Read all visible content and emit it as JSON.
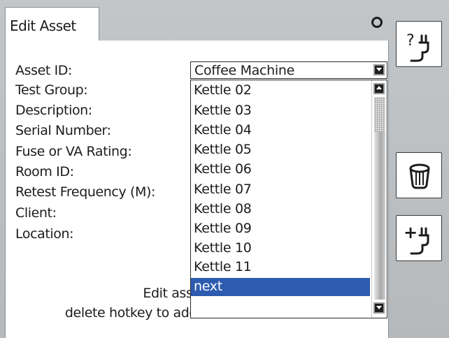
{
  "tab": {
    "title": "Edit Asset"
  },
  "form": {
    "labels": [
      "Asset ID:",
      "Test Group:",
      "Description:",
      "Serial Number:",
      "Fuse or VA Rating:",
      "Room ID:",
      "Retest Frequency (M):",
      "Client:",
      "Location:"
    ],
    "asset_id_value": "Coffee Machine"
  },
  "dropdown": {
    "items": [
      "Kettle 02",
      "Kettle 03",
      "Kettle 04",
      "Kettle 05",
      "Kettle 06",
      "Kettle 07",
      "Kettle 08",
      "Kettle 09",
      "Kettle 10",
      "Kettle 11"
    ],
    "selected_item": "next"
  },
  "hint": {
    "line1": "Edit asset inform",
    "line2": "delete hotkey to add or remove an asset."
  },
  "side_buttons": [
    {
      "icon": "help-plug-icon"
    },
    {
      "icon": "trash-icon"
    },
    {
      "icon": "add-plug-icon"
    }
  ],
  "colors": {
    "selection": "#2d5bb0",
    "frame": "#b9bdc0"
  }
}
